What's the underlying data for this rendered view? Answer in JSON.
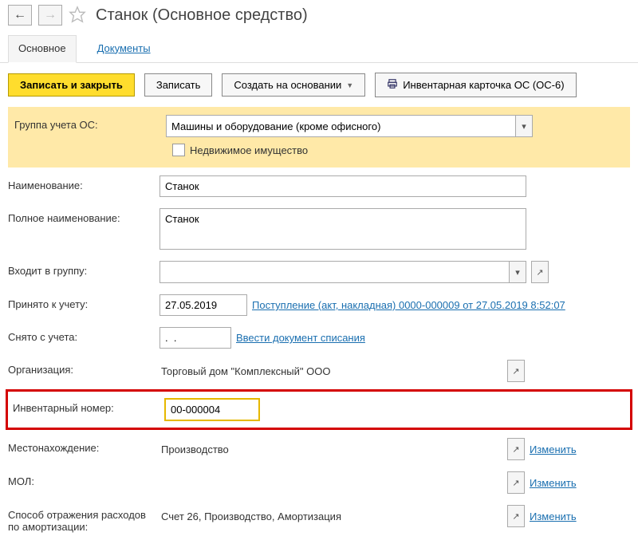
{
  "header": {
    "title": "Станок (Основное средство)"
  },
  "tabs": {
    "main": "Основное",
    "documents": "Документы"
  },
  "toolbar": {
    "save_close": "Записать и закрыть",
    "save": "Записать",
    "create_based": "Создать на основании",
    "inventory_card": "Инвентарная карточка ОС (ОС-6)"
  },
  "form": {
    "group_os_label": "Группа учета ОС:",
    "group_os_value": "Машины и оборудование (кроме офисного)",
    "real_estate_label": "Недвижимое имущество",
    "name_label": "Наименование:",
    "name_value": "Станок",
    "fullname_label": "Полное наименование:",
    "fullname_value": "Станок",
    "in_group_label": "Входит в группу:",
    "in_group_value": "",
    "accepted_label": "Принято к учету:",
    "accepted_date": "27.05.2019",
    "accepted_link": "Поступление (акт, накладная) 0000-000009 от 27.05.2019 8:52:07",
    "removed_label": "Снято с учета:",
    "removed_date": ".  .",
    "removed_link": "Ввести документ списания",
    "org_label": "Организация:",
    "org_value": "Торговый дом \"Комплексный\" ООО",
    "inv_label": "Инвентарный номер:",
    "inv_value": "00-000004",
    "location_label": "Местонахождение:",
    "location_value": "Производство",
    "mol_label": "МОЛ:",
    "mol_value": "",
    "amort_label": "Способ отражения расходов по амортизации:",
    "amort_value": "Счет 26, Производство, Амортизация",
    "change_link": "Изменить"
  }
}
